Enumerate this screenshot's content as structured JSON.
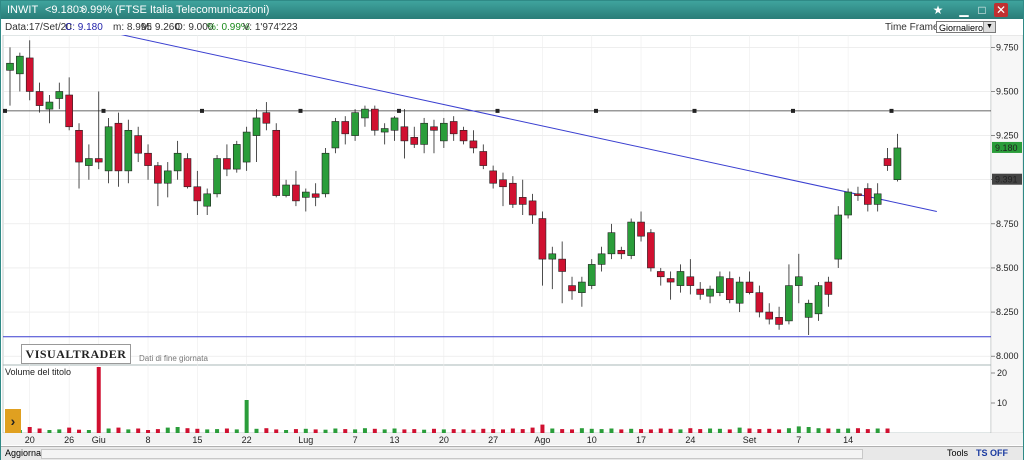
{
  "window": {
    "ticker": "INWIT",
    "price_change": "<9.180>",
    "pct_change": "0.99%",
    "name": "(FTSE Italia Telecomunicazioni)"
  },
  "info": {
    "data": "Data:17/Set/20",
    "close": "C: 9.180",
    "min": "m: 8.995",
    "max": "M: 9.260",
    "open": "O: 9.000",
    "pct": "%: 0.99%",
    "vol": "V: 1'974'223",
    "timeframe_label": "Time Frame",
    "timeframe_value": "Giornaliero"
  },
  "colors": {
    "up": "#2a9d3a",
    "down": "#d01030",
    "trend": "#3a3fd0",
    "bg": "#ffffff"
  },
  "logo": {
    "text": "VISUALTRADER",
    "sub": "Dati di fine giornata"
  },
  "bottom": {
    "aggiorna": "Aggiorna",
    "tools": "Tools",
    "ts_off": "TS OFF"
  },
  "chart_data": {
    "type": "candlestick",
    "price_axis": {
      "ticks": [
        "9.750",
        "9.500",
        "9.250",
        "9.000",
        "8.750",
        "8.500",
        "8.250",
        "8.000"
      ],
      "tick_values": [
        9.75,
        9.5,
        9.25,
        9.0,
        8.75,
        8.5,
        8.25,
        8.0
      ],
      "min": 7.95,
      "max": 9.82
    },
    "price_labels": {
      "last": "9.180",
      "last_value": 9.18,
      "level": "9.391",
      "level_value": 9.0
    },
    "x_labels": [
      {
        "label": "20",
        "i": 2
      },
      {
        "label": "26",
        "i": 6
      },
      {
        "label": "Giu",
        "i": 9,
        "month": true
      },
      {
        "label": "8",
        "i": 14
      },
      {
        "label": "15",
        "i": 19
      },
      {
        "label": "22",
        "i": 24
      },
      {
        "label": "Lug",
        "i": 30,
        "month": true
      },
      {
        "label": "7",
        "i": 35
      },
      {
        "label": "13",
        "i": 39
      },
      {
        "label": "20",
        "i": 44
      },
      {
        "label": "27",
        "i": 49
      },
      {
        "label": "Ago",
        "i": 54,
        "month": true
      },
      {
        "label": "10",
        "i": 59
      },
      {
        "label": "17",
        "i": 64
      },
      {
        "label": "24",
        "i": 69
      },
      {
        "label": "Set",
        "i": 75,
        "month": true
      },
      {
        "label": "7",
        "i": 80
      },
      {
        "label": "14",
        "i": 85
      }
    ],
    "horizontal_levels": [
      9.39,
      8.11
    ],
    "trendline": {
      "from": {
        "i": 9,
        "price": 9.85
      },
      "to": {
        "i": 94,
        "price": 8.82
      }
    },
    "volume_label": "Volume del titolo",
    "volume_axis": {
      "ticks": [
        "20",
        "10"
      ],
      "tick_values": [
        20,
        10
      ],
      "max": 22
    },
    "candles": [
      {
        "o": 9.62,
        "h": 9.75,
        "l": 9.42,
        "c": 9.66
      },
      {
        "o": 9.6,
        "h": 9.72,
        "l": 9.5,
        "c": 9.7
      },
      {
        "o": 9.69,
        "h": 9.79,
        "l": 9.45,
        "c": 9.5
      },
      {
        "o": 9.5,
        "h": 9.55,
        "l": 9.38,
        "c": 9.42
      },
      {
        "o": 9.4,
        "h": 9.48,
        "l": 9.32,
        "c": 9.44
      },
      {
        "o": 9.46,
        "h": 9.55,
        "l": 9.4,
        "c": 9.5
      },
      {
        "o": 9.48,
        "h": 9.58,
        "l": 9.28,
        "c": 9.3
      },
      {
        "o": 9.28,
        "h": 9.32,
        "l": 8.95,
        "c": 9.1
      },
      {
        "o": 9.08,
        "h": 9.2,
        "l": 9.0,
        "c": 9.12
      },
      {
        "o": 9.12,
        "h": 9.5,
        "l": 9.06,
        "c": 9.1
      },
      {
        "o": 9.05,
        "h": 9.35,
        "l": 8.98,
        "c": 9.3
      },
      {
        "o": 9.32,
        "h": 9.38,
        "l": 8.96,
        "c": 9.05
      },
      {
        "o": 9.05,
        "h": 9.34,
        "l": 8.98,
        "c": 9.28
      },
      {
        "o": 9.25,
        "h": 9.3,
        "l": 9.1,
        "c": 9.15
      },
      {
        "o": 9.15,
        "h": 9.2,
        "l": 9.0,
        "c": 9.08
      },
      {
        "o": 9.08,
        "h": 9.1,
        "l": 8.85,
        "c": 8.98
      },
      {
        "o": 8.98,
        "h": 9.1,
        "l": 8.9,
        "c": 9.05
      },
      {
        "o": 9.05,
        "h": 9.22,
        "l": 9.0,
        "c": 9.15
      },
      {
        "o": 9.12,
        "h": 9.15,
        "l": 8.95,
        "c": 8.96
      },
      {
        "o": 8.96,
        "h": 9.05,
        "l": 8.8,
        "c": 8.88
      },
      {
        "o": 8.85,
        "h": 8.95,
        "l": 8.8,
        "c": 8.92
      },
      {
        "o": 8.92,
        "h": 9.14,
        "l": 8.9,
        "c": 9.12
      },
      {
        "o": 9.12,
        "h": 9.2,
        "l": 9.02,
        "c": 9.06
      },
      {
        "o": 9.06,
        "h": 9.22,
        "l": 9.04,
        "c": 9.2
      },
      {
        "o": 9.1,
        "h": 9.3,
        "l": 9.05,
        "c": 9.27
      },
      {
        "o": 9.25,
        "h": 9.4,
        "l": 9.1,
        "c": 9.35
      },
      {
        "o": 9.38,
        "h": 9.44,
        "l": 9.28,
        "c": 9.32
      },
      {
        "o": 9.28,
        "h": 9.32,
        "l": 8.9,
        "c": 8.91
      },
      {
        "o": 8.91,
        "h": 9.0,
        "l": 8.9,
        "c": 8.97
      },
      {
        "o": 8.97,
        "h": 9.05,
        "l": 8.85,
        "c": 8.88
      },
      {
        "o": 8.9,
        "h": 8.95,
        "l": 8.82,
        "c": 8.93
      },
      {
        "o": 8.92,
        "h": 8.98,
        "l": 8.85,
        "c": 8.9
      },
      {
        "o": 8.92,
        "h": 9.18,
        "l": 8.9,
        "c": 9.15
      },
      {
        "o": 9.18,
        "h": 9.35,
        "l": 9.15,
        "c": 9.33
      },
      {
        "o": 9.33,
        "h": 9.36,
        "l": 9.2,
        "c": 9.26
      },
      {
        "o": 9.25,
        "h": 9.4,
        "l": 9.22,
        "c": 9.38
      },
      {
        "o": 9.35,
        "h": 9.42,
        "l": 9.3,
        "c": 9.4
      },
      {
        "o": 9.4,
        "h": 9.42,
        "l": 9.25,
        "c": 9.28
      },
      {
        "o": 9.27,
        "h": 9.32,
        "l": 9.2,
        "c": 9.29
      },
      {
        "o": 9.28,
        "h": 9.36,
        "l": 9.22,
        "c": 9.35
      },
      {
        "o": 9.3,
        "h": 9.4,
        "l": 9.12,
        "c": 9.22
      },
      {
        "o": 9.24,
        "h": 9.3,
        "l": 9.18,
        "c": 9.2
      },
      {
        "o": 9.2,
        "h": 9.35,
        "l": 9.15,
        "c": 9.32
      },
      {
        "o": 9.3,
        "h": 9.34,
        "l": 9.15,
        "c": 9.28
      },
      {
        "o": 9.22,
        "h": 9.35,
        "l": 9.18,
        "c": 9.32
      },
      {
        "o": 9.33,
        "h": 9.36,
        "l": 9.22,
        "c": 9.26
      },
      {
        "o": 9.28,
        "h": 9.3,
        "l": 9.2,
        "c": 9.22
      },
      {
        "o": 9.22,
        "h": 9.28,
        "l": 9.15,
        "c": 9.18
      },
      {
        "o": 9.16,
        "h": 9.2,
        "l": 9.06,
        "c": 9.08
      },
      {
        "o": 9.05,
        "h": 9.08,
        "l": 8.95,
        "c": 8.98
      },
      {
        "o": 9.0,
        "h": 9.04,
        "l": 8.85,
        "c": 8.96
      },
      {
        "o": 8.98,
        "h": 9.02,
        "l": 8.84,
        "c": 8.86
      },
      {
        "o": 8.9,
        "h": 9.0,
        "l": 8.8,
        "c": 8.86
      },
      {
        "o": 8.88,
        "h": 8.92,
        "l": 8.75,
        "c": 8.8
      },
      {
        "o": 8.78,
        "h": 8.82,
        "l": 8.4,
        "c": 8.55
      },
      {
        "o": 8.55,
        "h": 8.62,
        "l": 8.38,
        "c": 8.58
      },
      {
        "o": 8.55,
        "h": 8.65,
        "l": 8.3,
        "c": 8.48
      },
      {
        "o": 8.4,
        "h": 8.45,
        "l": 8.32,
        "c": 8.37
      },
      {
        "o": 8.36,
        "h": 8.45,
        "l": 8.28,
        "c": 8.42
      },
      {
        "o": 8.4,
        "h": 8.55,
        "l": 8.38,
        "c": 8.52
      },
      {
        "o": 8.52,
        "h": 8.62,
        "l": 8.48,
        "c": 8.58
      },
      {
        "o": 8.58,
        "h": 8.75,
        "l": 8.55,
        "c": 8.7
      },
      {
        "o": 8.6,
        "h": 8.62,
        "l": 8.55,
        "c": 8.58
      },
      {
        "o": 8.57,
        "h": 8.78,
        "l": 8.55,
        "c": 8.76
      },
      {
        "o": 8.76,
        "h": 8.82,
        "l": 8.65,
        "c": 8.68
      },
      {
        "o": 8.7,
        "h": 8.72,
        "l": 8.48,
        "c": 8.5
      },
      {
        "o": 8.48,
        "h": 8.5,
        "l": 8.4,
        "c": 8.45
      },
      {
        "o": 8.44,
        "h": 8.48,
        "l": 8.32,
        "c": 8.42
      },
      {
        "o": 8.4,
        "h": 8.52,
        "l": 8.36,
        "c": 8.48
      },
      {
        "o": 8.45,
        "h": 8.55,
        "l": 8.35,
        "c": 8.4
      },
      {
        "o": 8.38,
        "h": 8.42,
        "l": 8.32,
        "c": 8.35
      },
      {
        "o": 8.34,
        "h": 8.4,
        "l": 8.3,
        "c": 8.38
      },
      {
        "o": 8.36,
        "h": 8.48,
        "l": 8.34,
        "c": 8.45
      },
      {
        "o": 8.44,
        "h": 8.48,
        "l": 8.3,
        "c": 8.32
      },
      {
        "o": 8.3,
        "h": 8.45,
        "l": 8.25,
        "c": 8.42
      },
      {
        "o": 8.42,
        "h": 8.48,
        "l": 8.35,
        "c": 8.36
      },
      {
        "o": 8.36,
        "h": 8.4,
        "l": 8.22,
        "c": 8.25
      },
      {
        "o": 8.25,
        "h": 8.3,
        "l": 8.18,
        "c": 8.21
      },
      {
        "o": 8.22,
        "h": 8.28,
        "l": 8.15,
        "c": 8.18
      },
      {
        "o": 8.2,
        "h": 8.52,
        "l": 8.18,
        "c": 8.4
      },
      {
        "o": 8.4,
        "h": 8.58,
        "l": 8.3,
        "c": 8.45
      },
      {
        "o": 8.22,
        "h": 8.32,
        "l": 8.12,
        "c": 8.3
      },
      {
        "o": 8.24,
        "h": 8.42,
        "l": 8.2,
        "c": 8.4
      },
      {
        "o": 8.42,
        "h": 8.45,
        "l": 8.28,
        "c": 8.35
      },
      {
        "o": 8.55,
        "h": 8.85,
        "l": 8.5,
        "c": 8.8
      },
      {
        "o": 8.8,
        "h": 8.95,
        "l": 8.78,
        "c": 8.93
      },
      {
        "o": 8.92,
        "h": 8.96,
        "l": 8.88,
        "c": 8.91
      },
      {
        "o": 8.95,
        "h": 8.98,
        "l": 8.82,
        "c": 8.86
      },
      {
        "o": 8.86,
        "h": 8.98,
        "l": 8.82,
        "c": 8.92
      },
      {
        "o": 9.12,
        "h": 9.18,
        "l": 9.05,
        "c": 9.08
      },
      {
        "o": 9.0,
        "h": 9.26,
        "l": 8.99,
        "c": 9.18
      }
    ],
    "volumes": [
      1.2,
      1.0,
      2.0,
      1.5,
      1.0,
      1.2,
      1.8,
      1.1,
      1.0,
      22.0,
      1.5,
      1.8,
      1.2,
      1.5,
      1.0,
      1.3,
      1.8,
      2.0,
      1.6,
      1.4,
      1.2,
      1.3,
      1.5,
      1.2,
      11.0,
      1.4,
      1.6,
      1.2,
      1.0,
      1.3,
      1.4,
      1.2,
      1.1,
      1.5,
      1.3,
      1.2,
      1.6,
      1.4,
      1.2,
      1.5,
      1.2,
      1.3,
      1.1,
      1.4,
      1.2,
      1.3,
      1.2,
      1.1,
      1.4,
      1.3,
      1.2,
      1.5,
      1.3,
      1.8,
      2.8,
      1.5,
      1.3,
      1.2,
      1.6,
      1.4,
      1.3,
      1.5,
      1.2,
      1.4,
      1.3,
      1.2,
      1.5,
      1.4,
      1.2,
      1.6,
      1.3,
      1.5,
      1.4,
      1.2,
      1.8,
      1.5,
      1.3,
      1.4,
      1.2,
      1.6,
      2.2,
      2.0,
      1.6,
      1.5,
      1.4,
      1.5,
      1.6,
      1.3,
      1.5,
      1.5
    ]
  }
}
